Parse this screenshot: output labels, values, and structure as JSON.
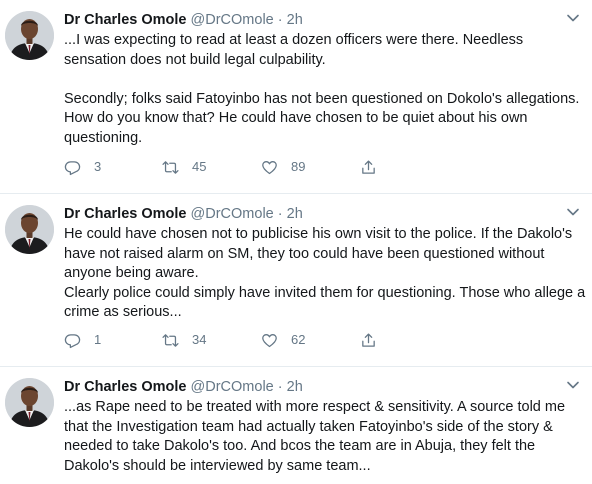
{
  "tweets": [
    {
      "author": "Dr Charles Omole",
      "handle": "@DrCOmole",
      "dot": "·",
      "time": "2h",
      "text": "...I was expecting to read at least a dozen officers were there. Needless sensation does not build legal culpability.\n\nSecondly; folks said Fatoyinbo has not been questioned on Dokolo's allegations. How do you know that? He could have chosen to be quiet about his own questioning.",
      "replies": "3",
      "retweets": "45",
      "likes": "89"
    },
    {
      "author": "Dr Charles Omole",
      "handle": "@DrCOmole",
      "dot": "·",
      "time": "2h",
      "text": "He could have chosen not to publicise his own visit to the police. If the Dakolo's have not raised alarm on SM, they too could have been questioned without anyone being aware.\nClearly police could simply have invited them for questioning. Those who allege a crime as serious...",
      "replies": "1",
      "retweets": "34",
      "likes": "62"
    },
    {
      "author": "Dr Charles Omole",
      "handle": "@DrCOmole",
      "dot": "·",
      "time": "2h",
      "text": "...as Rape need to be treated with more respect & sensitivity. A source told me that the Investigation team had actually taken Fatoyinbo's side of the story & needed to take Dakolo's too. And bcos the team are in Abuja, they felt the Dakolo's should be interviewed by same team..."
    }
  ],
  "icons": {
    "avatar": "profile-photo",
    "menu": "chevron-down-icon",
    "reply": "reply-icon",
    "retweet": "retweet-icon",
    "like": "heart-icon",
    "share": "share-icon"
  },
  "colors": {
    "text": "#14171a",
    "secondary": "#657786",
    "divider": "#e6ecf0"
  }
}
